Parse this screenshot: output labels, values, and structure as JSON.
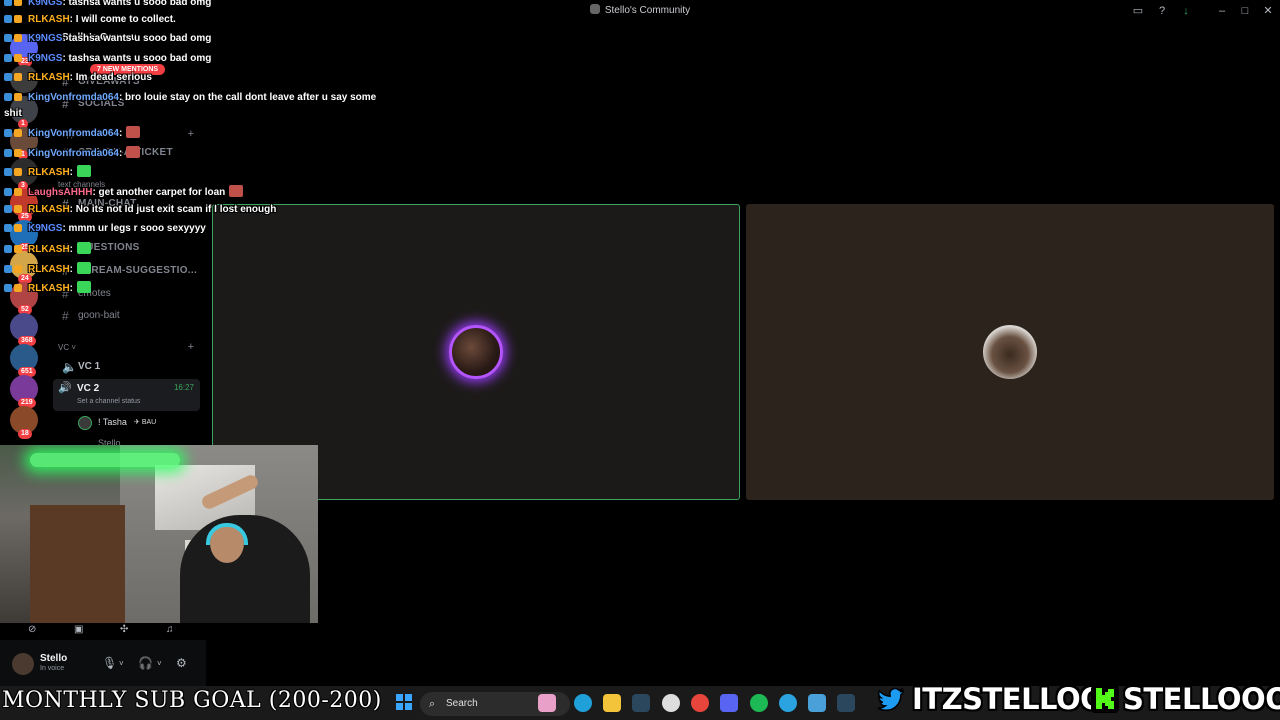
{
  "window": {
    "title": "Stello's Community"
  },
  "servers": [
    {
      "color": "#5865f2",
      "badge": "23"
    },
    {
      "color": "#3c3c3c",
      "badge": ""
    },
    {
      "color": "#404249",
      "badge": "1"
    },
    {
      "color": "#6a4b3a",
      "badge": "1"
    },
    {
      "color": "#2c2c2c",
      "badge": "3"
    },
    {
      "color": "#c0392b",
      "badge": "25"
    },
    {
      "color": "#1e6fb8",
      "badge": "25"
    },
    {
      "color": "#d4a64a",
      "badge": "24"
    },
    {
      "color": "#b04444",
      "badge": "52"
    },
    {
      "color": "#4a4a8a",
      "badge": "368"
    },
    {
      "color": "#2a5a8a",
      "badge": "651"
    },
    {
      "color": "#7a3a9a",
      "badge": "219"
    },
    {
      "color": "#8a4a2a",
      "badge": "18"
    }
  ],
  "sidebar": {
    "server_name": "Stello's Commu",
    "mentions_pill": "7 NEW MENTIONS",
    "channels": [
      {
        "name": "GIVEAWAYS",
        "style": "upper"
      },
      {
        "name": "SOCIALS",
        "style": "upper"
      },
      {
        "name": "support",
        "style": "cat"
      },
      {
        "name": "CREATE-A-TICKET",
        "style": "upper"
      },
      {
        "name": "text channels",
        "style": "cat"
      },
      {
        "name": "MAIN-CHAT",
        "style": "upper"
      },
      {
        "name": "QUESTIONS",
        "style": "upper"
      },
      {
        "name": "STREAM-SUGGESTIO...",
        "style": "upper"
      },
      {
        "name": "emotes",
        "style": "normal"
      },
      {
        "name": "goon-bait",
        "style": "normal"
      }
    ],
    "vc_category": "VC",
    "vc1": "VC 1",
    "vc2": "VC 2",
    "vc2_time": "16:27",
    "vc2_status": "Set a channel status",
    "vc_members": [
      "! Tasha",
      "Stello"
    ],
    "member_tag": "BAU"
  },
  "user": {
    "name": "Stello",
    "status": "In voice"
  },
  "chat": [
    {
      "user": "K9NGS",
      "color": "#5b8cff",
      "text": ": tashsa wants u sooo bad omg",
      "emote": ""
    },
    {
      "user": "RLKASH",
      "color": "#ffb020",
      "text": ": I will come to collect.",
      "emote": ""
    },
    {
      "user": "K9NGS",
      "color": "#5b8cff",
      "text": ": tashsa wants u sooo bad omg",
      "emote": ""
    },
    {
      "user": "K9NGS",
      "color": "#5b8cff",
      "text": ": tashsa wants u sooo bad omg",
      "emote": ""
    },
    {
      "user": "RLKASH",
      "color": "#ffb020",
      "text": ": Im dead serious",
      "emote": ""
    },
    {
      "user": "KingVonfromda064",
      "color": "#6ea8ff",
      "text": ": bro louie stay on the call dont leave after u say some",
      "emote": ""
    },
    {
      "user": "",
      "color": "#ffffff",
      "text": "shit",
      "emote": ""
    },
    {
      "user": "KingVonfromda064",
      "color": "#6ea8ff",
      "text": ":",
      "emote": "#c0504a"
    },
    {
      "user": "KingVonfromda064",
      "color": "#6ea8ff",
      "text": ":",
      "emote": "#c0504a"
    },
    {
      "user": "RLKASH",
      "color": "#ffb020",
      "text": ":",
      "emote": "#3ad65a"
    },
    {
      "user": "LaughsAHHH",
      "color": "#ff6a8a",
      "text": ": get another carpet for loan",
      "emote": "#c0504a"
    },
    {
      "user": "RLKASH",
      "color": "#ffb020",
      "text": ": No its not Id just exit scam if I lost enough",
      "emote": ""
    },
    {
      "user": "K9NGS",
      "color": "#5b8cff",
      "text": ": mmm ur legs r sooo sexyyyy",
      "emote": ""
    },
    {
      "user": "RLKASH",
      "color": "#ffb020",
      "text": ":",
      "emote": "#3ad65a"
    },
    {
      "user": "RLKASH",
      "color": "#ffb020",
      "text": ":",
      "emote": "#3ad65a"
    },
    {
      "user": "RLKASH",
      "color": "#ffb020",
      "text": ":",
      "emote": "#3ad65a"
    }
  ],
  "overlay": {
    "sub_goal": "MONTHLY SUB GOAL (200-200)",
    "twitter": "ITZSTELLOO",
    "kick": "STELLOOO"
  },
  "taskbar": {
    "search_placeholder": "Search",
    "apps": [
      {
        "icon": "garden-icon",
        "color": "#e8a0c8"
      },
      {
        "icon": "edge-icon",
        "color": "#1fa0d8"
      },
      {
        "icon": "file-explorer-icon",
        "color": "#f3c43a"
      },
      {
        "icon": "steam-icon",
        "color": "#2a475e"
      },
      {
        "icon": "chatgpt-icon",
        "color": "#dddddd"
      },
      {
        "icon": "chrome-icon",
        "color": "#e8453c"
      },
      {
        "icon": "discord-icon",
        "color": "#5865f2"
      },
      {
        "icon": "spotify-icon",
        "color": "#1db954"
      },
      {
        "icon": "telegram-icon",
        "color": "#2aa3e0"
      },
      {
        "icon": "notepad-icon",
        "color": "#4aa0d8"
      },
      {
        "icon": "steam2-icon",
        "color": "#2a475e"
      }
    ]
  },
  "colors": {
    "speaking_border": "#3ba55d",
    "twitter_blue": "#1d9bf0",
    "kick_green": "#53fc18"
  }
}
